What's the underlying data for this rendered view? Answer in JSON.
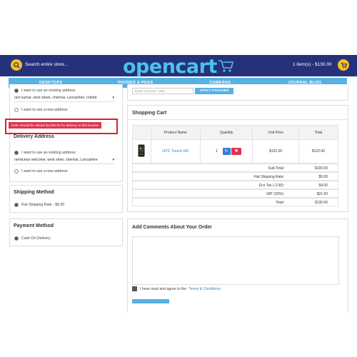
{
  "header": {
    "search_label": "Search entire store...",
    "logo_text": "opencart",
    "cart_summary": "1 item(s) - $130.00"
  },
  "nav": [
    "DESKTOPS",
    "PHONES & PDAS",
    "CAMERAS",
    "JOURNAL BLOG"
  ],
  "payment_address": {
    "existing_label": "I want to use an existing address",
    "existing_value": "ram kumar, west street, chennai, Lancashire, United",
    "new_label": "I want to use a new address"
  },
  "alert_text": "Order should be atleast $1,000.00 for delivery to this location",
  "delivery_address": {
    "title": "Delivery Address",
    "existing_label": "I want to use an existing address",
    "existing_value": "ramkumar welcome, west stree, chennai, Lancashire",
    "new_label": "I want to use a new address"
  },
  "shipping_method": {
    "title": "Shipping Method",
    "option": "Flat Shipping Rate - $8.00"
  },
  "payment_method": {
    "title": "Payment Method",
    "option": "Cash On Delivery"
  },
  "voucher": {
    "placeholder": "Enter voucher code",
    "button": "APPLY VOUCHER"
  },
  "cart": {
    "title": "Shopping Cart",
    "columns": [
      "Product Name",
      "Quantity",
      "Unit Price",
      "Total"
    ],
    "item": {
      "name": "HTC Touch HD",
      "quantity": "1",
      "unit_price": "$122.00",
      "total": "$122.00"
    },
    "totals": [
      {
        "label": "Sub-Total:",
        "value": "$100.00"
      },
      {
        "label": "Flat Shipping Rate:",
        "value": "$5.00"
      },
      {
        "label": "Eco Tax (-2.00):",
        "value": "$4.00"
      },
      {
        "label": "VAT (20%):",
        "value": "$21.00"
      },
      {
        "label": "Total:",
        "value": "$130.00"
      }
    ]
  },
  "comments": {
    "title": "Add Comments About Your Order"
  },
  "terms": {
    "text": "I have read and agree to the",
    "link": "Terms & Conditions"
  },
  "colors": {
    "header_bg": "#25327a",
    "nav_bg": "#57b1e2",
    "accent_yellow": "#f7c11b",
    "alert_red": "#e0334d",
    "remove_button": "#e0334d",
    "update_button": "#3a7bd5"
  }
}
